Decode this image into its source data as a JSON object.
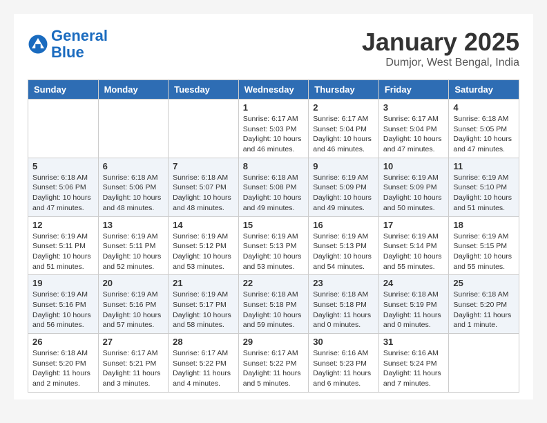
{
  "header": {
    "logo_line1": "General",
    "logo_line2": "Blue",
    "month": "January 2025",
    "location": "Dumjor, West Bengal, India"
  },
  "weekdays": [
    "Sunday",
    "Monday",
    "Tuesday",
    "Wednesday",
    "Thursday",
    "Friday",
    "Saturday"
  ],
  "weeks": [
    [
      {
        "day": "",
        "sunrise": "",
        "sunset": "",
        "daylight": ""
      },
      {
        "day": "",
        "sunrise": "",
        "sunset": "",
        "daylight": ""
      },
      {
        "day": "",
        "sunrise": "",
        "sunset": "",
        "daylight": ""
      },
      {
        "day": "1",
        "sunrise": "Sunrise: 6:17 AM",
        "sunset": "Sunset: 5:03 PM",
        "daylight": "Daylight: 10 hours and 46 minutes."
      },
      {
        "day": "2",
        "sunrise": "Sunrise: 6:17 AM",
        "sunset": "Sunset: 5:04 PM",
        "daylight": "Daylight: 10 hours and 46 minutes."
      },
      {
        "day": "3",
        "sunrise": "Sunrise: 6:17 AM",
        "sunset": "Sunset: 5:04 PM",
        "daylight": "Daylight: 10 hours and 47 minutes."
      },
      {
        "day": "4",
        "sunrise": "Sunrise: 6:18 AM",
        "sunset": "Sunset: 5:05 PM",
        "daylight": "Daylight: 10 hours and 47 minutes."
      }
    ],
    [
      {
        "day": "5",
        "sunrise": "Sunrise: 6:18 AM",
        "sunset": "Sunset: 5:06 PM",
        "daylight": "Daylight: 10 hours and 47 minutes."
      },
      {
        "day": "6",
        "sunrise": "Sunrise: 6:18 AM",
        "sunset": "Sunset: 5:06 PM",
        "daylight": "Daylight: 10 hours and 48 minutes."
      },
      {
        "day": "7",
        "sunrise": "Sunrise: 6:18 AM",
        "sunset": "Sunset: 5:07 PM",
        "daylight": "Daylight: 10 hours and 48 minutes."
      },
      {
        "day": "8",
        "sunrise": "Sunrise: 6:18 AM",
        "sunset": "Sunset: 5:08 PM",
        "daylight": "Daylight: 10 hours and 49 minutes."
      },
      {
        "day": "9",
        "sunrise": "Sunrise: 6:19 AM",
        "sunset": "Sunset: 5:09 PM",
        "daylight": "Daylight: 10 hours and 49 minutes."
      },
      {
        "day": "10",
        "sunrise": "Sunrise: 6:19 AM",
        "sunset": "Sunset: 5:09 PM",
        "daylight": "Daylight: 10 hours and 50 minutes."
      },
      {
        "day": "11",
        "sunrise": "Sunrise: 6:19 AM",
        "sunset": "Sunset: 5:10 PM",
        "daylight": "Daylight: 10 hours and 51 minutes."
      }
    ],
    [
      {
        "day": "12",
        "sunrise": "Sunrise: 6:19 AM",
        "sunset": "Sunset: 5:11 PM",
        "daylight": "Daylight: 10 hours and 51 minutes."
      },
      {
        "day": "13",
        "sunrise": "Sunrise: 6:19 AM",
        "sunset": "Sunset: 5:11 PM",
        "daylight": "Daylight: 10 hours and 52 minutes."
      },
      {
        "day": "14",
        "sunrise": "Sunrise: 6:19 AM",
        "sunset": "Sunset: 5:12 PM",
        "daylight": "Daylight: 10 hours and 53 minutes."
      },
      {
        "day": "15",
        "sunrise": "Sunrise: 6:19 AM",
        "sunset": "Sunset: 5:13 PM",
        "daylight": "Daylight: 10 hours and 53 minutes."
      },
      {
        "day": "16",
        "sunrise": "Sunrise: 6:19 AM",
        "sunset": "Sunset: 5:13 PM",
        "daylight": "Daylight: 10 hours and 54 minutes."
      },
      {
        "day": "17",
        "sunrise": "Sunrise: 6:19 AM",
        "sunset": "Sunset: 5:14 PM",
        "daylight": "Daylight: 10 hours and 55 minutes."
      },
      {
        "day": "18",
        "sunrise": "Sunrise: 6:19 AM",
        "sunset": "Sunset: 5:15 PM",
        "daylight": "Daylight: 10 hours and 55 minutes."
      }
    ],
    [
      {
        "day": "19",
        "sunrise": "Sunrise: 6:19 AM",
        "sunset": "Sunset: 5:16 PM",
        "daylight": "Daylight: 10 hours and 56 minutes."
      },
      {
        "day": "20",
        "sunrise": "Sunrise: 6:19 AM",
        "sunset": "Sunset: 5:16 PM",
        "daylight": "Daylight: 10 hours and 57 minutes."
      },
      {
        "day": "21",
        "sunrise": "Sunrise: 6:19 AM",
        "sunset": "Sunset: 5:17 PM",
        "daylight": "Daylight: 10 hours and 58 minutes."
      },
      {
        "day": "22",
        "sunrise": "Sunrise: 6:18 AM",
        "sunset": "Sunset: 5:18 PM",
        "daylight": "Daylight: 10 hours and 59 minutes."
      },
      {
        "day": "23",
        "sunrise": "Sunrise: 6:18 AM",
        "sunset": "Sunset: 5:18 PM",
        "daylight": "Daylight: 11 hours and 0 minutes."
      },
      {
        "day": "24",
        "sunrise": "Sunrise: 6:18 AM",
        "sunset": "Sunset: 5:19 PM",
        "daylight": "Daylight: 11 hours and 0 minutes."
      },
      {
        "day": "25",
        "sunrise": "Sunrise: 6:18 AM",
        "sunset": "Sunset: 5:20 PM",
        "daylight": "Daylight: 11 hours and 1 minute."
      }
    ],
    [
      {
        "day": "26",
        "sunrise": "Sunrise: 6:18 AM",
        "sunset": "Sunset: 5:20 PM",
        "daylight": "Daylight: 11 hours and 2 minutes."
      },
      {
        "day": "27",
        "sunrise": "Sunrise: 6:17 AM",
        "sunset": "Sunset: 5:21 PM",
        "daylight": "Daylight: 11 hours and 3 minutes."
      },
      {
        "day": "28",
        "sunrise": "Sunrise: 6:17 AM",
        "sunset": "Sunset: 5:22 PM",
        "daylight": "Daylight: 11 hours and 4 minutes."
      },
      {
        "day": "29",
        "sunrise": "Sunrise: 6:17 AM",
        "sunset": "Sunset: 5:22 PM",
        "daylight": "Daylight: 11 hours and 5 minutes."
      },
      {
        "day": "30",
        "sunrise": "Sunrise: 6:16 AM",
        "sunset": "Sunset: 5:23 PM",
        "daylight": "Daylight: 11 hours and 6 minutes."
      },
      {
        "day": "31",
        "sunrise": "Sunrise: 6:16 AM",
        "sunset": "Sunset: 5:24 PM",
        "daylight": "Daylight: 11 hours and 7 minutes."
      },
      {
        "day": "",
        "sunrise": "",
        "sunset": "",
        "daylight": ""
      }
    ]
  ]
}
